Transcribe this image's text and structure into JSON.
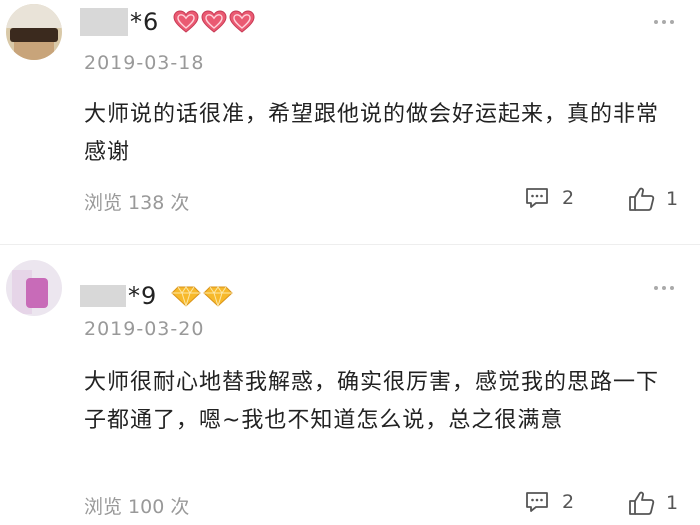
{
  "comments": [
    {
      "username": "*6",
      "date": "2019-03-18",
      "text": "大师说的话很准，希望跟他说的做会好运起来，真的非常感谢",
      "views": "浏览 138 次",
      "reply_count": "2",
      "like_count": "1",
      "badge": "heart-icon",
      "badge_color": "#e8526b"
    },
    {
      "username": "*9",
      "date": "2019-03-20",
      "text": "大师很耐心地替我解惑，确实很厉害，感觉我的思路一下子都通了，嗯~我也不知道怎么说，总之很满意",
      "views": "浏览 100 次",
      "reply_count": "2",
      "like_count": "1",
      "badge": "diamond-icon",
      "badge_color": "#f5b324"
    }
  ]
}
